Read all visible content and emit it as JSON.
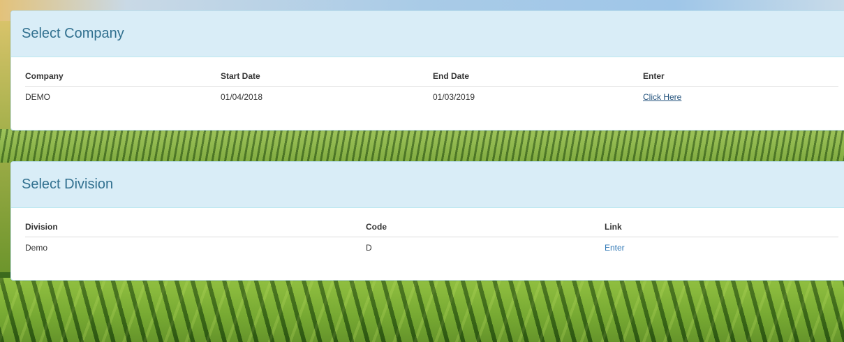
{
  "company_panel": {
    "title": "Select Company",
    "headers": [
      "Company",
      "Start Date",
      "End Date",
      "Enter"
    ],
    "rows": [
      {
        "company": "DEMO",
        "start_date": "01/04/2018",
        "end_date": "01/03/2019",
        "enter_link": "Click Here"
      }
    ]
  },
  "division_panel": {
    "title": "Select Division",
    "headers": [
      "Division",
      "Code",
      "Link"
    ],
    "rows": [
      {
        "division": "Demo",
        "code": "D",
        "link": "Enter"
      }
    ]
  },
  "colors": {
    "panel_heading_bg": "#d9edf7",
    "panel_title": "#31708f",
    "link": "#337ab7"
  }
}
